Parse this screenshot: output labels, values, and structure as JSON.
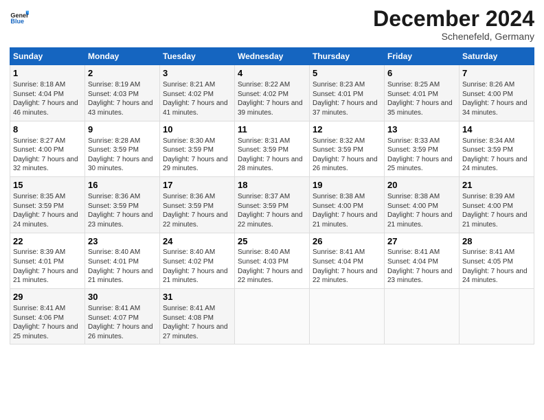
{
  "logo": {
    "line1": "General",
    "line2": "Blue"
  },
  "title": "December 2024",
  "subtitle": "Schenefeld, Germany",
  "days_header": [
    "Sunday",
    "Monday",
    "Tuesday",
    "Wednesday",
    "Thursday",
    "Friday",
    "Saturday"
  ],
  "weeks": [
    [
      {
        "day": "1",
        "sunrise": "8:18 AM",
        "sunset": "4:04 PM",
        "daylight": "7 hours and 46 minutes."
      },
      {
        "day": "2",
        "sunrise": "8:19 AM",
        "sunset": "4:03 PM",
        "daylight": "7 hours and 43 minutes."
      },
      {
        "day": "3",
        "sunrise": "8:21 AM",
        "sunset": "4:02 PM",
        "daylight": "7 hours and 41 minutes."
      },
      {
        "day": "4",
        "sunrise": "8:22 AM",
        "sunset": "4:02 PM",
        "daylight": "7 hours and 39 minutes."
      },
      {
        "day": "5",
        "sunrise": "8:23 AM",
        "sunset": "4:01 PM",
        "daylight": "7 hours and 37 minutes."
      },
      {
        "day": "6",
        "sunrise": "8:25 AM",
        "sunset": "4:01 PM",
        "daylight": "7 hours and 35 minutes."
      },
      {
        "day": "7",
        "sunrise": "8:26 AM",
        "sunset": "4:00 PM",
        "daylight": "7 hours and 34 minutes."
      }
    ],
    [
      {
        "day": "8",
        "sunrise": "8:27 AM",
        "sunset": "4:00 PM",
        "daylight": "7 hours and 32 minutes."
      },
      {
        "day": "9",
        "sunrise": "8:28 AM",
        "sunset": "3:59 PM",
        "daylight": "7 hours and 30 minutes."
      },
      {
        "day": "10",
        "sunrise": "8:30 AM",
        "sunset": "3:59 PM",
        "daylight": "7 hours and 29 minutes."
      },
      {
        "day": "11",
        "sunrise": "8:31 AM",
        "sunset": "3:59 PM",
        "daylight": "7 hours and 28 minutes."
      },
      {
        "day": "12",
        "sunrise": "8:32 AM",
        "sunset": "3:59 PM",
        "daylight": "7 hours and 26 minutes."
      },
      {
        "day": "13",
        "sunrise": "8:33 AM",
        "sunset": "3:59 PM",
        "daylight": "7 hours and 25 minutes."
      },
      {
        "day": "14",
        "sunrise": "8:34 AM",
        "sunset": "3:59 PM",
        "daylight": "7 hours and 24 minutes."
      }
    ],
    [
      {
        "day": "15",
        "sunrise": "8:35 AM",
        "sunset": "3:59 PM",
        "daylight": "7 hours and 24 minutes."
      },
      {
        "day": "16",
        "sunrise": "8:36 AM",
        "sunset": "3:59 PM",
        "daylight": "7 hours and 23 minutes."
      },
      {
        "day": "17",
        "sunrise": "8:36 AM",
        "sunset": "3:59 PM",
        "daylight": "7 hours and 22 minutes."
      },
      {
        "day": "18",
        "sunrise": "8:37 AM",
        "sunset": "3:59 PM",
        "daylight": "7 hours and 22 minutes."
      },
      {
        "day": "19",
        "sunrise": "8:38 AM",
        "sunset": "4:00 PM",
        "daylight": "7 hours and 21 minutes."
      },
      {
        "day": "20",
        "sunrise": "8:38 AM",
        "sunset": "4:00 PM",
        "daylight": "7 hours and 21 minutes."
      },
      {
        "day": "21",
        "sunrise": "8:39 AM",
        "sunset": "4:00 PM",
        "daylight": "7 hours and 21 minutes."
      }
    ],
    [
      {
        "day": "22",
        "sunrise": "8:39 AM",
        "sunset": "4:01 PM",
        "daylight": "7 hours and 21 minutes."
      },
      {
        "day": "23",
        "sunrise": "8:40 AM",
        "sunset": "4:01 PM",
        "daylight": "7 hours and 21 minutes."
      },
      {
        "day": "24",
        "sunrise": "8:40 AM",
        "sunset": "4:02 PM",
        "daylight": "7 hours and 21 minutes."
      },
      {
        "day": "25",
        "sunrise": "8:40 AM",
        "sunset": "4:03 PM",
        "daylight": "7 hours and 22 minutes."
      },
      {
        "day": "26",
        "sunrise": "8:41 AM",
        "sunset": "4:04 PM",
        "daylight": "7 hours and 22 minutes."
      },
      {
        "day": "27",
        "sunrise": "8:41 AM",
        "sunset": "4:04 PM",
        "daylight": "7 hours and 23 minutes."
      },
      {
        "day": "28",
        "sunrise": "8:41 AM",
        "sunset": "4:05 PM",
        "daylight": "7 hours and 24 minutes."
      }
    ],
    [
      {
        "day": "29",
        "sunrise": "8:41 AM",
        "sunset": "4:06 PM",
        "daylight": "7 hours and 25 minutes."
      },
      {
        "day": "30",
        "sunrise": "8:41 AM",
        "sunset": "4:07 PM",
        "daylight": "7 hours and 26 minutes."
      },
      {
        "day": "31",
        "sunrise": "8:41 AM",
        "sunset": "4:08 PM",
        "daylight": "7 hours and 27 minutes."
      },
      null,
      null,
      null,
      null
    ]
  ],
  "labels": {
    "sunrise_prefix": "Sunrise: ",
    "sunset_prefix": "Sunset: ",
    "daylight_prefix": "Daylight: "
  }
}
